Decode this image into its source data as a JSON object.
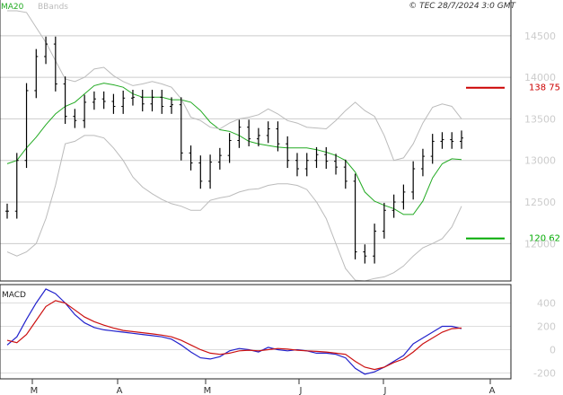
{
  "chart_data": [
    {
      "type": "line",
      "title": "",
      "legend": [
        {
          "name": "MA20",
          "color": "#22aa22"
        },
        {
          "name": "BBands",
          "color": "#bbbbbb"
        }
      ],
      "credit": "© TEC 28/7/2024 3:0 GMT",
      "y_tick_labels": [
        "14500",
        "14000",
        "13500",
        "13000",
        "12500",
        "12000"
      ],
      "ylim": [
        11550,
        14930
      ],
      "x_month_labels": [
        "M",
        "A",
        "M",
        "J",
        "J",
        "A"
      ],
      "grid": true,
      "levels": [
        {
          "label": "138 75",
          "value": 13875,
          "color": "#cc0000"
        },
        {
          "label": "120 62",
          "value": 12062,
          "color": "#00aa00"
        }
      ],
      "series": [
        {
          "name": "MA20",
          "color": "#22aa22",
          "values": [
            12960,
            13000,
            13150,
            13280,
            13430,
            13560,
            13650,
            13700,
            13800,
            13900,
            13930,
            13910,
            13880,
            13800,
            13760,
            13760,
            13760,
            13730,
            13730,
            13700,
            13600,
            13460,
            13370,
            13350,
            13300,
            13230,
            13200,
            13180,
            13160,
            13150,
            13150,
            13150,
            13130,
            13100,
            13060,
            13000,
            12860,
            12620,
            12510,
            12460,
            12420,
            12350,
            12350,
            12510,
            12790,
            12960,
            13020,
            13010
          ]
        },
        {
          "name": "BB upper",
          "color": "#bbbbbb",
          "values": [
            14800,
            14800,
            14780,
            14600,
            14420,
            14200,
            13980,
            13950,
            14000,
            14100,
            14120,
            14020,
            13950,
            13900,
            13920,
            13950,
            13920,
            13880,
            13740,
            13520,
            13480,
            13400,
            13380,
            13450,
            13500,
            13520,
            13550,
            13620,
            13560,
            13480,
            13450,
            13400,
            13390,
            13380,
            13480,
            13600,
            13700,
            13600,
            13530,
            13300,
            13000,
            13030,
            13200,
            13450,
            13640,
            13680,
            13650,
            13500
          ]
        },
        {
          "name": "BB lower",
          "color": "#bbbbbb",
          "values": [
            11900,
            11850,
            11900,
            12000,
            12300,
            12700,
            13200,
            13230,
            13300,
            13300,
            13270,
            13150,
            13000,
            12800,
            12680,
            12600,
            12530,
            12480,
            12450,
            12400,
            12400,
            12520,
            12550,
            12570,
            12620,
            12650,
            12660,
            12700,
            12720,
            12720,
            12700,
            12650,
            12500,
            12300,
            12000,
            11700,
            11560,
            11550,
            11580,
            11600,
            11650,
            11730,
            11850,
            11950,
            12000,
            12060,
            12200,
            12450
          ]
        },
        {
          "name": "Price",
          "color": "#000000",
          "values": [
            12390,
            13000,
            13840,
            14250,
            14400,
            13920,
            13530,
            13480,
            13700,
            13740,
            13710,
            13650,
            13750,
            13760,
            13680,
            13760,
            13650,
            13670,
            13090,
            12970,
            12750,
            12980,
            13060,
            13240,
            13400,
            13260,
            13300,
            13380,
            13200,
            13000,
            12900,
            13000,
            13070,
            12990,
            12920,
            12750,
            11900,
            11850,
            12150,
            12400,
            12500,
            12620,
            12900,
            13050,
            13230,
            13250,
            13230,
            13270
          ]
        }
      ]
    },
    {
      "type": "line",
      "title": "MACD",
      "y_tick_labels": [
        "400",
        "200",
        "0",
        "-200"
      ],
      "ylim": [
        -250,
        550
      ],
      "grid": true,
      "series": [
        {
          "name": "MACD",
          "color": "#2222cc",
          "values": [
            40,
            110,
            260,
            400,
            520,
            480,
            400,
            300,
            230,
            190,
            170,
            160,
            150,
            140,
            130,
            120,
            110,
            90,
            40,
            -20,
            -70,
            -80,
            -60,
            -10,
            10,
            0,
            -20,
            20,
            0,
            -10,
            0,
            -10,
            -30,
            -30,
            -40,
            -70,
            -160,
            -210,
            -190,
            -150,
            -100,
            -50,
            50,
            100,
            150,
            200,
            200,
            180
          ]
        },
        {
          "name": "Signal",
          "color": "#cc1111",
          "values": [
            80,
            60,
            130,
            250,
            370,
            420,
            400,
            340,
            280,
            240,
            210,
            185,
            165,
            155,
            145,
            135,
            125,
            110,
            80,
            40,
            0,
            -30,
            -40,
            -30,
            -10,
            -5,
            -10,
            0,
            10,
            5,
            -5,
            -10,
            -15,
            -20,
            -30,
            -40,
            -100,
            -150,
            -170,
            -150,
            -110,
            -80,
            -20,
            50,
            100,
            150,
            180,
            185
          ]
        }
      ]
    }
  ]
}
